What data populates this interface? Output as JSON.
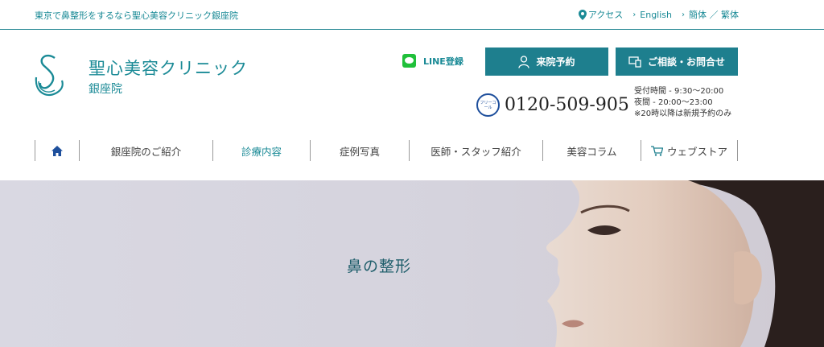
{
  "topbar": {
    "tagline": "東京で鼻整形をするなら聖心美容クリニック銀座院",
    "access": "アクセス",
    "english": "English",
    "chinese": "簡体 ／ 繁体"
  },
  "header": {
    "logo_title": "聖心美容クリニック",
    "logo_sub": "銀座院",
    "line_label": "LINE登録",
    "reserve_label": "来院予約",
    "consult_label": "ご相談・お問合せ",
    "free_icon_text": "フリーコール",
    "phone": "0120-509-905",
    "hours": [
      "受付時間 - 9:30〜20:00",
      "夜間 - 20:00〜23:00",
      "※20時以降は新規予約のみ"
    ]
  },
  "nav": {
    "items": [
      {
        "label": ""
      },
      {
        "label": "銀座院のご紹介"
      },
      {
        "label": "診療内容"
      },
      {
        "label": "症例写真"
      },
      {
        "label": "医師・スタッフ紹介"
      },
      {
        "label": "美容コラム"
      },
      {
        "label": "ウェブストア"
      }
    ]
  },
  "hero": {
    "title": "鼻の整形"
  },
  "colors": {
    "accent": "#1a8a96",
    "button": "#1e7f8e",
    "line_green": "#20c03a",
    "hero_bg": "#d7d6e0"
  },
  "icons": {
    "access": "map-pin-icon",
    "home": "home-icon",
    "cart": "cart-icon",
    "reserve": "person-icon",
    "consult": "monitor-icon",
    "line": "line-icon"
  }
}
